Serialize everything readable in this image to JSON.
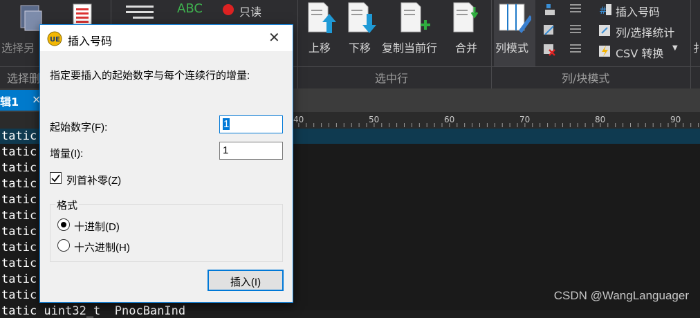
{
  "ribbon": {
    "select_copy_label": "选择另",
    "select_group_label": "选择删",
    "abc_label": "ABC",
    "readonly_label": "只读",
    "move_up_label": "上移",
    "move_down_label": "下移",
    "copy_line_label": "复制当前行",
    "merge_label": "合并",
    "selected_line_group": "选中行",
    "column_mode_label": "列模式",
    "insert_number_label": "插入号码",
    "column_stats_label": "列/选择统计",
    "csv_convert_label": "CSV 转换",
    "column_block_group": "列/块模式",
    "trailing_label": "扌"
  },
  "tab": {
    "label": "辑1",
    "close": "×"
  },
  "ruler": {
    "marks": [
      "40",
      "50",
      "60",
      "70",
      "80",
      "90"
    ]
  },
  "editor": {
    "lines": [
      "tatic",
      "tatic",
      "tatic",
      "tatic",
      "tatic",
      "tatic",
      "tatic",
      "tatic",
      "tatic",
      "tatic",
      "tatic"
    ],
    "last_line": "tatic uint32_t  PnocBanInd"
  },
  "dialog": {
    "title": "插入号码",
    "description": "指定要插入的起始数字与每个连续行的增量:",
    "start_label": "起始数字(F):",
    "start_value": "1",
    "increment_label": "增量(I):",
    "increment_value": "1",
    "leading_zero_label": "列首补零(Z)",
    "leading_zero_checked": true,
    "format_group_label": "格式",
    "decimal_label": "十进制(D)",
    "hex_label": "十六进制(H)",
    "selected_format": "decimal",
    "insert_button": "插入(I)"
  },
  "watermark": "CSDN @WangLanguager",
  "colors": {
    "accent": "#007acc",
    "dialog_border": "#1883d7",
    "ribbon_bg": "#2d2d30"
  }
}
